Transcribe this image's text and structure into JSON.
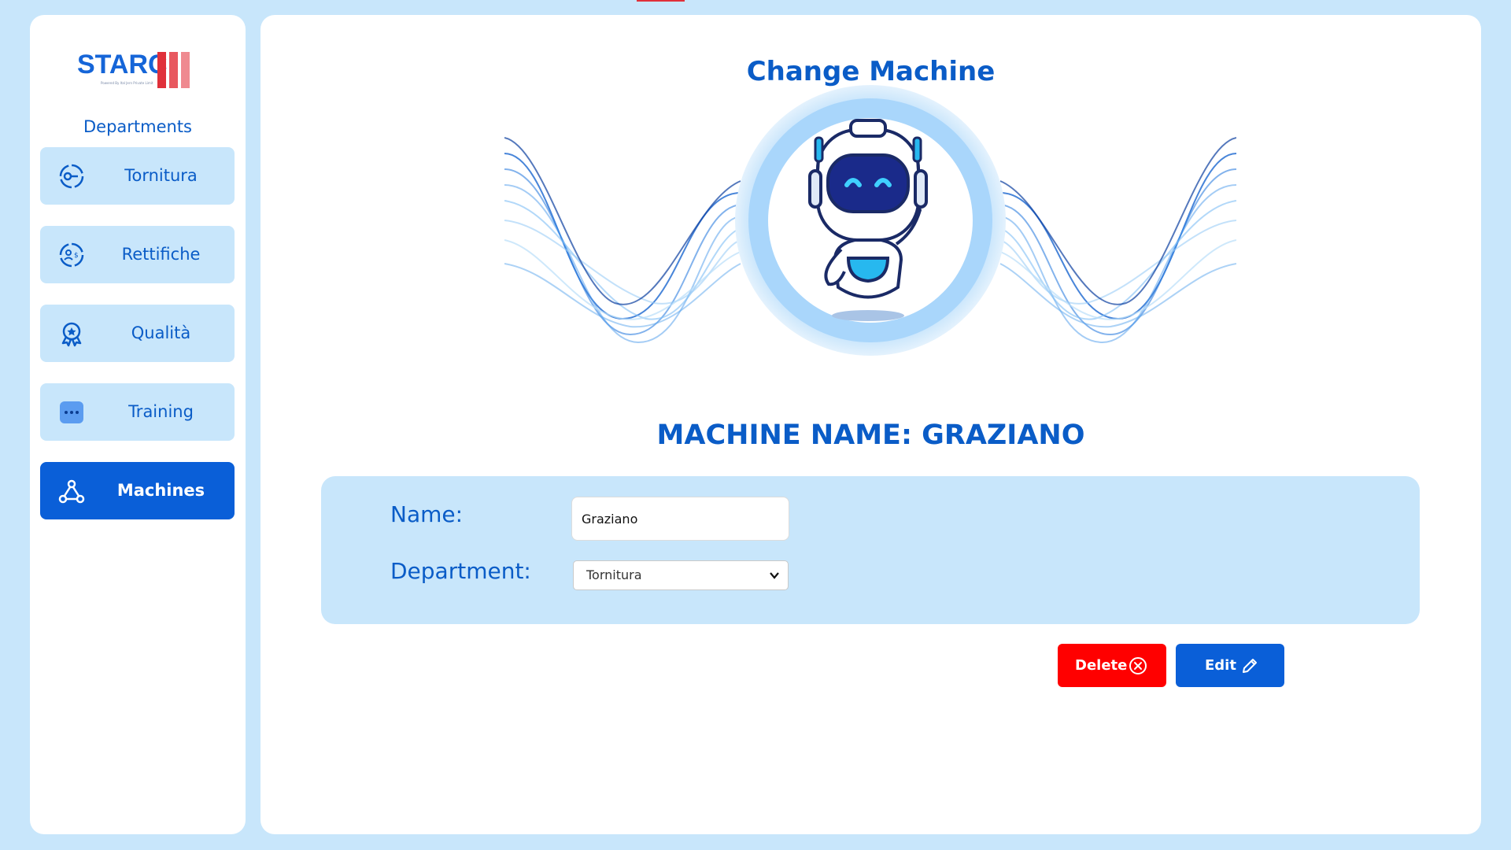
{
  "brand": {
    "name": "STARC",
    "tagline": "Powered By Ital Jern Private Limit",
    "colors": [
      "#e0303a",
      "#e8585f",
      "#ef8a90"
    ]
  },
  "sidebar": {
    "title": "Departments",
    "items": [
      {
        "label": "Tornitura",
        "icon": "turning-icon",
        "active": false
      },
      {
        "label": "Rettifiche",
        "icon": "grinding-icon",
        "active": false
      },
      {
        "label": "Qualità",
        "icon": "quality-badge-icon",
        "active": false
      },
      {
        "label": "Training",
        "icon": "chat-dots-icon",
        "active": false
      },
      {
        "label": "Machines",
        "icon": "nodes-icon",
        "active": true
      }
    ]
  },
  "main": {
    "title": "Change Machine",
    "illustration": "robot-mascot",
    "heading": "MACHINE NAME: GRAZIANO",
    "form": {
      "name_label": "Name:",
      "name_value": "Graziano",
      "department_label": "Department:",
      "department_value": "Tornitura"
    },
    "actions": {
      "delete_label": "Delete",
      "edit_label": "Edit"
    }
  },
  "colors": {
    "accent": "#0a5fd8",
    "text_blue": "#0a5cc7",
    "background": "#c8e6fb",
    "danger": "#ff0000"
  }
}
